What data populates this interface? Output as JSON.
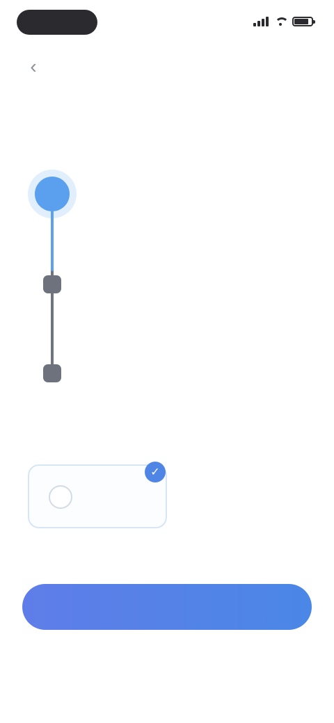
{
  "status_bar": {
    "time": "",
    "icons": [
      "signal-icon",
      "wifi-icon",
      "battery-icon"
    ]
  },
  "nav": {
    "back_icon": "chevron-left-icon",
    "back_glyph": "‹"
  },
  "title": "",
  "timeline": {
    "steps": [
      {
        "title": "",
        "description": "",
        "state": "current"
      },
      {
        "title": "",
        "description": "",
        "state": "upcoming"
      },
      {
        "title": "",
        "description": "",
        "state": "upcoming"
      }
    ]
  },
  "plans": {
    "selected": {
      "label": "",
      "price": "",
      "badge_glyph": "✓"
    },
    "alternative": {
      "label": ""
    }
  },
  "terms_note": "",
  "cta": {
    "label": ""
  },
  "restore_link": "",
  "footer_note": "",
  "colors": {
    "accent": "#5aa0ef",
    "cta_start": "#5f7de8",
    "cta_end": "#4a87e6",
    "timeline_inactive": "#6d727c",
    "text_dark": "#2a2e38",
    "text_muted": "#8d929c"
  }
}
